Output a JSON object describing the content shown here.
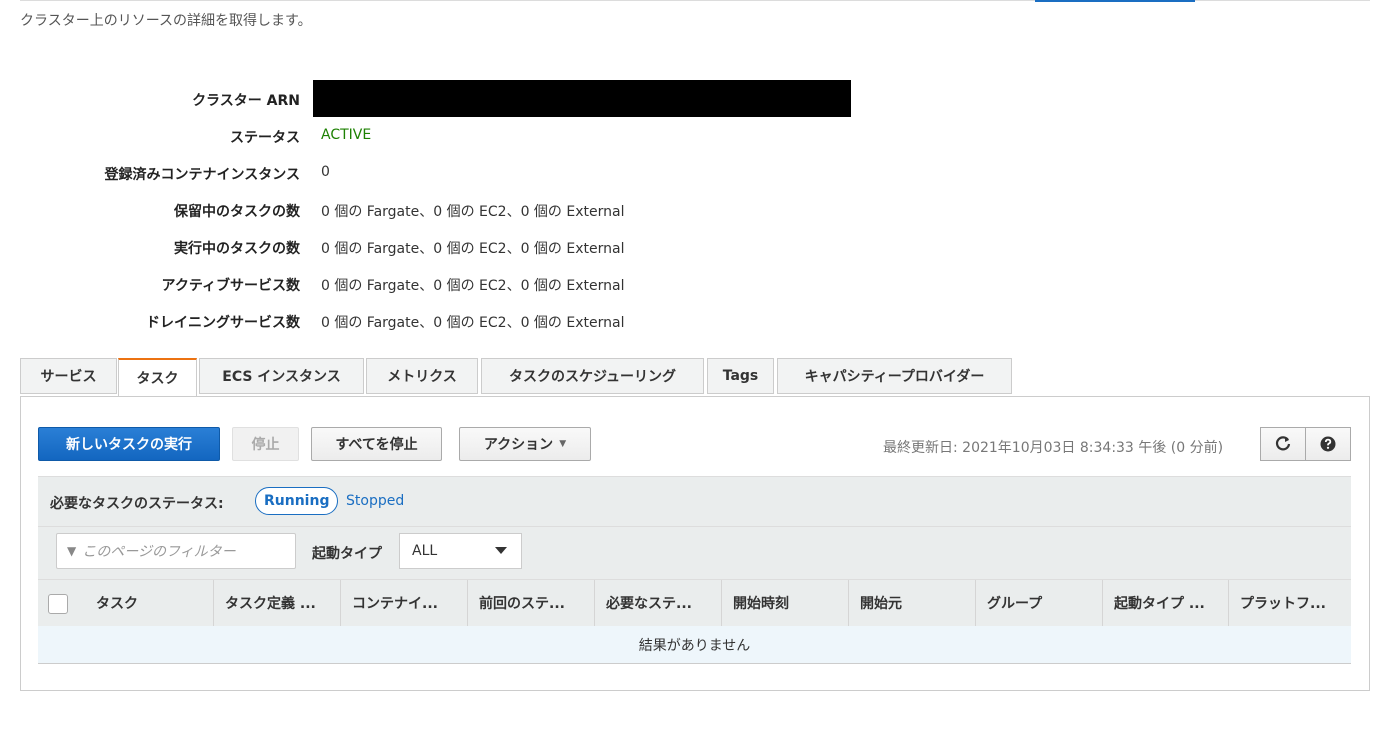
{
  "page": {
    "subtitle": "クラスター上のリソースの詳細を取得します。"
  },
  "details": [
    {
      "label": "クラスター ARN",
      "value": ""
    },
    {
      "label": "ステータス",
      "value": "ACTIVE"
    },
    {
      "label": "登録済みコンテナインスタンス",
      "value": "0"
    },
    {
      "label": "保留中のタスクの数",
      "value": "0 個の Fargate、0 個の EC2、0 個の External"
    },
    {
      "label": "実行中のタスクの数",
      "value": "0 個の Fargate、0 個の EC2、0 個の External"
    },
    {
      "label": "アクティブサービス数",
      "value": "0 個の Fargate、0 個の EC2、0 個の External"
    },
    {
      "label": "ドレイニングサービス数",
      "value": "0 個の Fargate、0 個の EC2、0 個の External"
    }
  ],
  "tabs": [
    "サービス",
    "タスク",
    "ECS インスタンス",
    "メトリクス",
    "タスクのスケジューリング",
    "Tags",
    "キャパシティープロバイダー"
  ],
  "active_tab": "タスク",
  "toolbar": {
    "new_task": "新しいタスクの実行",
    "stop": "停止",
    "stop_all": "すべてを停止",
    "actions": "アクション",
    "last_updated": "最終更新日: 2021年10月03日 8:34:33 午後 (0 分前)"
  },
  "desired_status": {
    "label": "必要なタスクのステータス:",
    "selected": "Running",
    "other": "Stopped"
  },
  "filter": {
    "placeholder": "このページのフィルター",
    "launch_type_label": "起動タイプ",
    "launch_type_value": "ALL"
  },
  "table": {
    "columns": [
      "タスク",
      "タスク定義 ...",
      "コンテナイ...",
      "前回のステ...",
      "必要なステ...",
      "開始時刻",
      "開始元",
      "グループ",
      "起動タイプ ...",
      "プラットフ..."
    ],
    "empty_message": "結果がありません"
  },
  "colors": {
    "status_active": "#1d8102",
    "link": "#1a6ec2",
    "tab_accent": "#ec7211",
    "primary_button": "#1366c0"
  },
  "icons": [
    "refresh-icon",
    "help-icon",
    "filter-icon",
    "caret-down-icon"
  ]
}
